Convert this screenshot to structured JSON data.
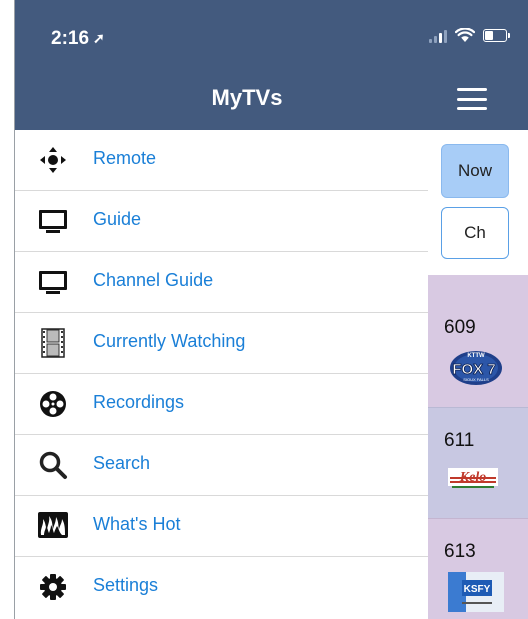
{
  "status_bar": {
    "time": "2:16",
    "location_arrow": "➚",
    "battery_level": 0.45
  },
  "header": {
    "title": "MyTVs",
    "menu_icon": "hamburger-icon"
  },
  "menu": [
    {
      "label": "Remote",
      "icon": "dpad-icon"
    },
    {
      "label": "Guide",
      "icon": "tv-icon"
    },
    {
      "label": "Channel Guide",
      "icon": "tv-icon"
    },
    {
      "label": "Currently Watching",
      "icon": "film-strip-icon"
    },
    {
      "label": "Recordings",
      "icon": "film-reel-icon"
    },
    {
      "label": "Search",
      "icon": "magnifier-icon"
    },
    {
      "label": "What's Hot",
      "icon": "flames-icon"
    },
    {
      "label": "Settings",
      "icon": "gear-icon"
    }
  ],
  "side_panel": {
    "now_label": "Now",
    "ch_label": "Ch",
    "channels": [
      {
        "number": "609",
        "logo_top": "KTTW",
        "logo_main": "FOX 7",
        "logo_sub": "SIOUX FALLS"
      },
      {
        "number": "611",
        "logo_main": "Kelo"
      },
      {
        "number": "613",
        "logo_main": "KSFY"
      }
    ]
  },
  "colors": {
    "header_bg": "#435a7e",
    "link_blue": "#1a7fd7",
    "now_button_bg": "#a8cdf7"
  }
}
